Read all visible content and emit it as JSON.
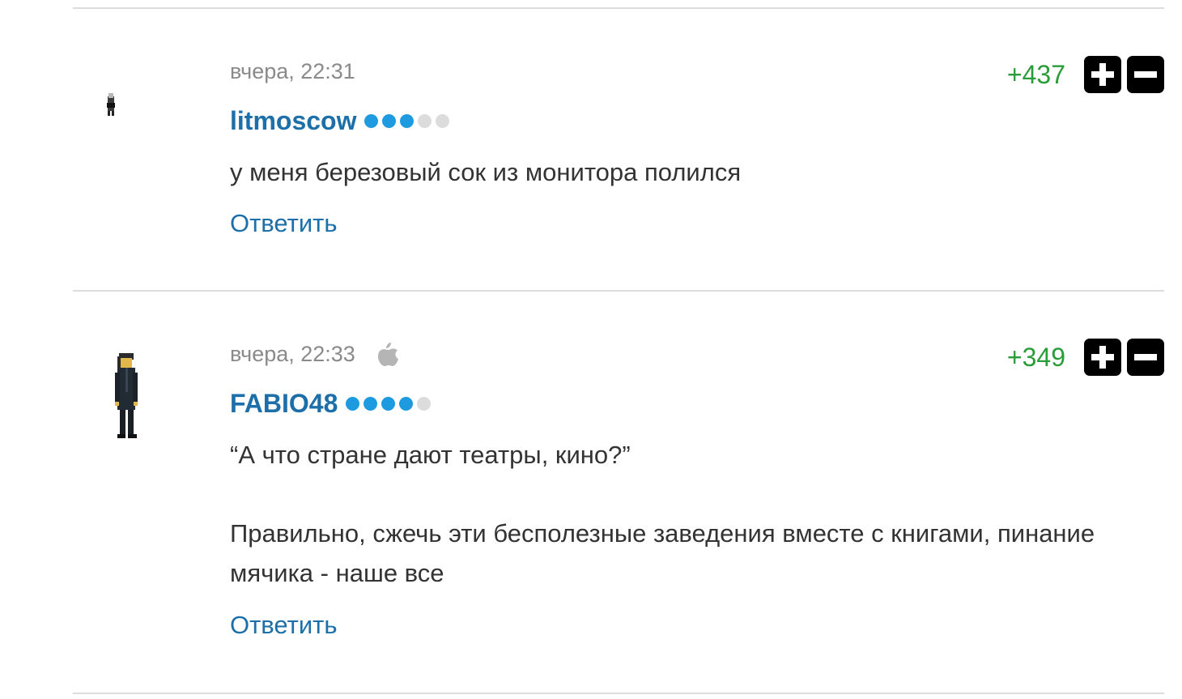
{
  "comments": [
    {
      "date": "вчера, 22:31",
      "author": "litmoscow",
      "rating_filled": 3,
      "rating_total": 5,
      "score": "+437",
      "device_icon": "",
      "text": [
        "у меня березовый сок из монитора полился"
      ],
      "reply_label": "Ответить"
    },
    {
      "date": "вчера, 22:33",
      "author": "FABIO48",
      "rating_filled": 4,
      "rating_total": 5,
      "score": "+349",
      "device_icon": "apple-icon",
      "text": [
        "“А что стране дают театры, кино?”",
        "Правильно, сжечь эти бесполезные заведения вместе с книгами, пинание мячика - наше все"
      ],
      "reply_label": "Ответить"
    }
  ],
  "colors": {
    "author": "#1c6fa8",
    "score_positive": "#2a9d3a",
    "rating_dot_on": "#1e9be0",
    "rating_dot_off": "#dcdcdc",
    "date": "#8a8a8a",
    "text": "#333333"
  }
}
